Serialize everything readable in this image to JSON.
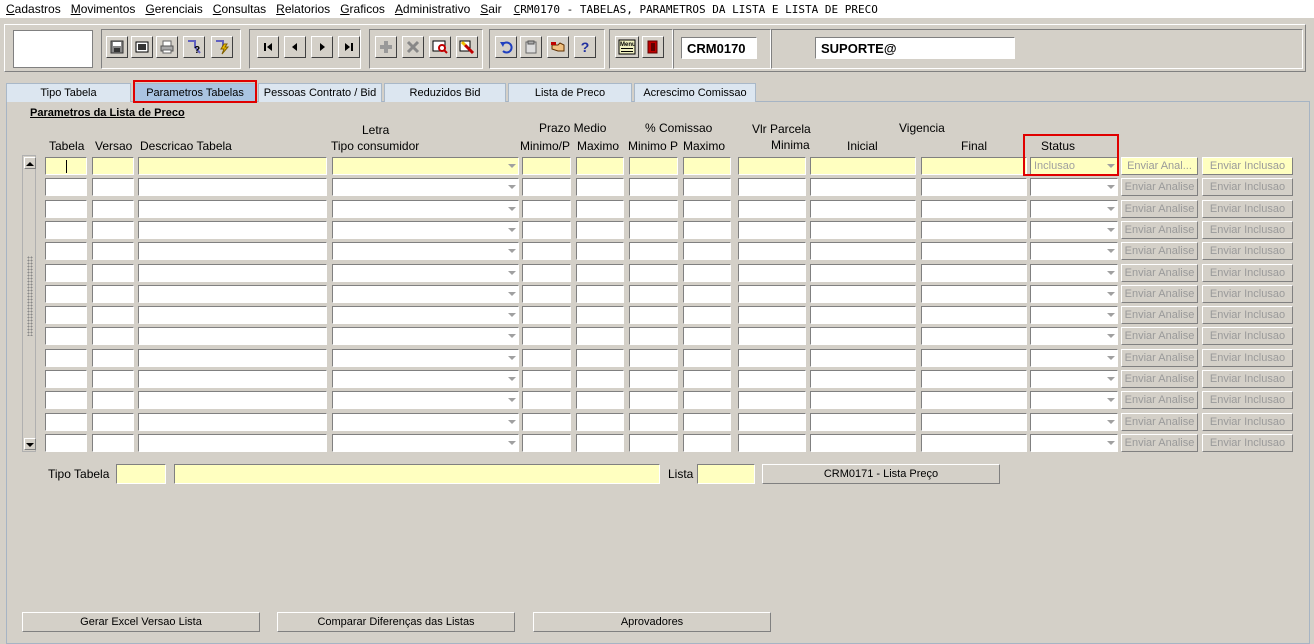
{
  "menu": {
    "items": [
      {
        "underline": "C",
        "rest": "adastros"
      },
      {
        "underline": "M",
        "rest": "ovimentos"
      },
      {
        "underline": "G",
        "rest": "erenciais"
      },
      {
        "underline": "C",
        "rest": "onsultas"
      },
      {
        "underline": "R",
        "rest": "elatorios"
      },
      {
        "underline": "G",
        "rest": "raficos"
      },
      {
        "underline": "A",
        "rest": "dministrativo"
      },
      {
        "underline": "S",
        "rest": "air"
      }
    ],
    "title_underline": "C",
    "title_rest": "RM0170 - TABELAS, PARAMETROS DA LISTA E LISTA DE PRECO"
  },
  "toolbar": {
    "form_code": "CRM0170",
    "user": "SUPORTE@",
    "icons": [
      "save-icon",
      "print-preview-icon",
      "print-icon",
      "query-help-icon",
      "execute-query-icon",
      "first-record-icon",
      "previous-record-icon",
      "next-record-icon",
      "last-record-icon",
      "insert-record-icon",
      "delete-record-icon",
      "search-record-icon",
      "edit-record-icon",
      "undo-icon",
      "clipboard-icon",
      "key-hand-icon",
      "help-icon",
      "menu-icon",
      "exit-icon"
    ]
  },
  "tabs": [
    {
      "label": "Tipo Tabela"
    },
    {
      "label": "Parametros Tabelas"
    },
    {
      "label": "Pessoas Contrato / Bid"
    },
    {
      "label": "Reduzidos Bid"
    },
    {
      "label": "Lista de Preco"
    },
    {
      "label": "Acrescimo Comissao"
    }
  ],
  "section_title": "Parametros da Lista de Preco",
  "headers": {
    "tabela": "Tabela",
    "versao": "Versao",
    "descricao": "Descricao Tabela",
    "letra": "Letra",
    "tipo_consumidor": "Tipo consumidor",
    "prazo_medio": "Prazo Medio",
    "prazo_minimo": "Minimo/P",
    "prazo_maximo": "Maximo",
    "comissao": "% Comissao",
    "comissao_minimo": "Minimo P",
    "comissao_maximo": "Maximo",
    "vlr_parcela": "Vlr Parcela",
    "minima": "Minima",
    "vigencia": "Vigencia",
    "inicial": "Inicial",
    "final": "Final",
    "status": "Status"
  },
  "grid": {
    "status_value": "Inclusao",
    "first_row_analise": "Enviar Anal...",
    "analise_label": "Enviar Analise",
    "inclusao_label": "Enviar Inclusao"
  },
  "footer": {
    "tipo_tabela_label": "Tipo Tabela",
    "lista_label": "Lista",
    "lista_preco_button": "CRM0171 - Lista Preço",
    "gerar_excel_button": "Gerar Excel Versao Lista",
    "comparar_button": "Comparar Diferenças das Listas",
    "aprovadores_button": "Aprovadores"
  },
  "colors": {
    "field_yellow": "#ffffc0",
    "highlight_red": "#e00000",
    "active_tab": "#aac4e2"
  }
}
